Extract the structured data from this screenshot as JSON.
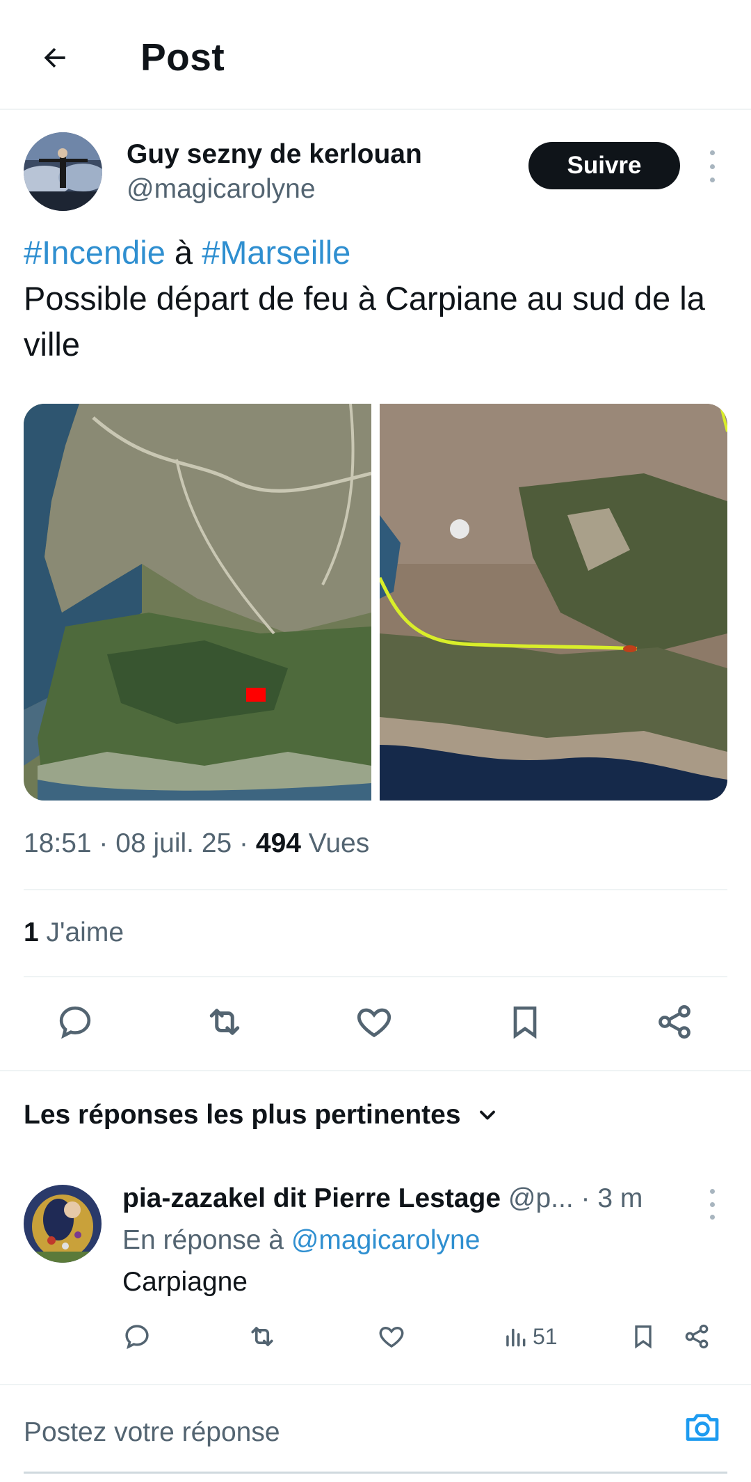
{
  "header": {
    "title": "Post"
  },
  "author": {
    "name": "Guy sezny de kerlouan",
    "handle": "@magicarolyne",
    "follow_label": "Suivre"
  },
  "post": {
    "hashtag1": "#Incendie",
    "connector": " à ",
    "hashtag2": "#Marseille",
    "text": "Possible départ de feu à Carpiane au sud de la ville"
  },
  "meta": {
    "time_date": "18:51 · 08 juil. 25 · ",
    "views_count": "494",
    "views_label": " Vues"
  },
  "likes": {
    "count": "1",
    "label": " J'aime"
  },
  "replies_sort": {
    "label": "Les réponses les plus pertinentes"
  },
  "reply": {
    "name": "pia-zazakel dit Pierre Lestage",
    "handle": " @p...",
    "time": " · 3 m",
    "in_reply_prefix": "En réponse à ",
    "in_reply_mention": "@magicarolyne",
    "text": "Carpiagne",
    "views": "51"
  },
  "compose": {
    "placeholder": "Postez votre réponse"
  },
  "colors": {
    "accent": "#1d9bf0",
    "text": "#0f1419",
    "muted": "#536471"
  },
  "icons": [
    "arrow-left-icon",
    "more-vertical-icon",
    "reply-icon",
    "retweet-icon",
    "heart-icon",
    "bookmark-icon",
    "share-icon",
    "chevron-down-icon",
    "views-icon",
    "camera-icon"
  ]
}
